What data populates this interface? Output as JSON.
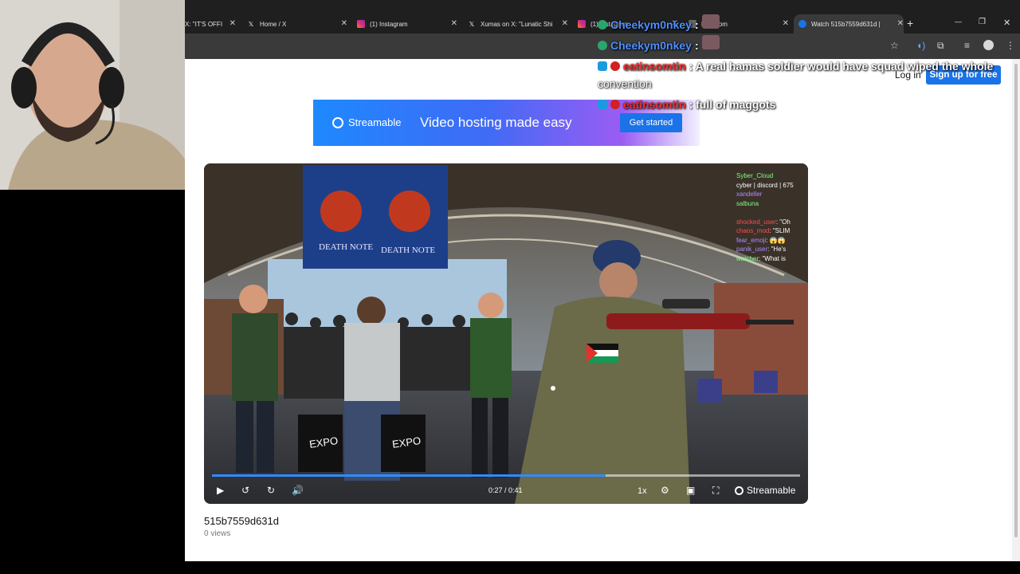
{
  "browser": {
    "tabs": [
      {
        "title": "X: \"IT'S OFFI",
        "icon": "x-logo-icon"
      },
      {
        "title": "Home / X",
        "icon": "x-logo-icon"
      },
      {
        "title": "(1) Instagram",
        "icon": "instagram-icon"
      },
      {
        "title": "Xumas on X: \"Lunatic Shi",
        "icon": "x-logo-icon"
      },
      {
        "title": "(1) Instagram",
        "icon": "instagram-icon"
      },
      {
        "title": "Fi...r.com",
        "icon": "generic-icon"
      },
      {
        "title": "Watch 515b7559d631d |",
        "icon": "streamable-icon",
        "active": true
      }
    ],
    "new_tab": "+",
    "window_controls": {
      "minimize": "—",
      "restore": "❐",
      "close": "✕"
    }
  },
  "header": {
    "login": "Log in",
    "signup": "Sign up for free"
  },
  "banner": {
    "brand": "Streamable",
    "tagline": "Video hosting made easy",
    "cta": "Get started"
  },
  "video": {
    "time": "0:27 / 0:41",
    "progress": 0.67,
    "speed": "1x",
    "brand": "Streamable",
    "banner_text_left": "DEATH NOTE",
    "banner_text_right": "DEATH NOTE",
    "bag_text": "EXPO",
    "chat_lines": [
      {
        "user": "Syber_Cloud",
        "text": ""
      },
      {
        "user": "",
        "text": "cyber | discord | 675"
      },
      {
        "user": "xandeller",
        "text": ""
      },
      {
        "user": "salbuna",
        "text": ""
      },
      {
        "user": "",
        "text": ""
      },
      {
        "user": "shocked_user",
        "text": "\"Oh"
      },
      {
        "user": "chaos_mod",
        "text": "\"SLIM"
      },
      {
        "user": "fear_emoji",
        "text": "😱😱"
      },
      {
        "user": "panik_user",
        "text": "\"He's"
      },
      {
        "user": "watcher",
        "text": "\"What is"
      }
    ]
  },
  "media": {
    "title": "515b7559d631d",
    "views": "0 views"
  },
  "overlay_chat": [
    {
      "user": "Cheekym0nkey",
      "color": "#4e8ffd",
      "text": ":",
      "emote": true
    },
    {
      "user": "Cheekym0nkey",
      "color": "#4e8ffd",
      "text": ":",
      "emote": true
    },
    {
      "user": "eatinsomtin",
      "color": "#ff2a2a",
      "text": ": A real hamas soldier would have squad wiped the whole",
      "cont": "convention"
    },
    {
      "user": "eatinsomtin",
      "color": "#ff2a2a",
      "text": ": full of maggots"
    }
  ],
  "colors": {
    "accent": "#1a73e8",
    "progress": "#2f8cff",
    "chrome_bg": "#1f1f1f"
  }
}
